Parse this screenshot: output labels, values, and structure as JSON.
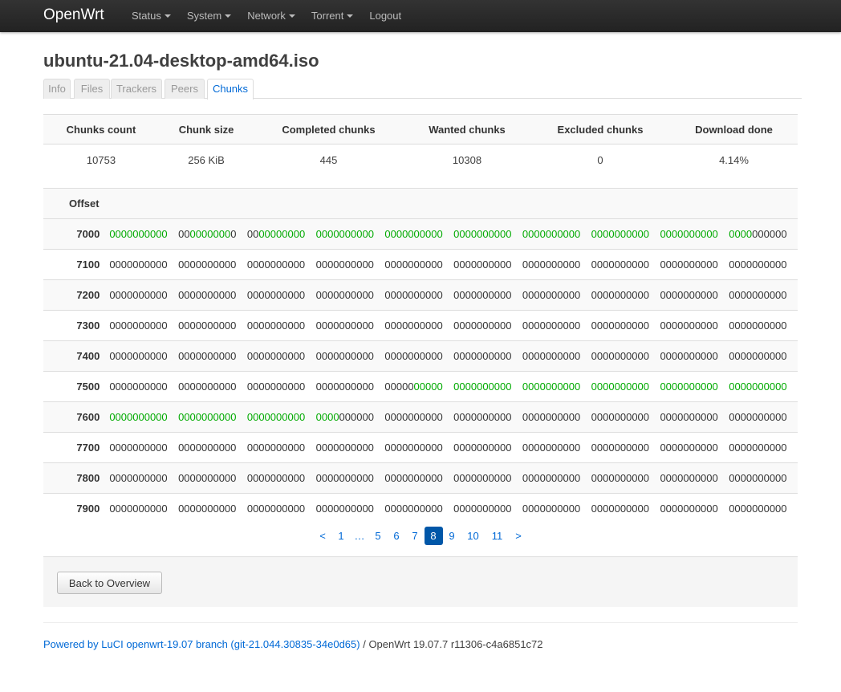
{
  "navbar": {
    "brand": "OpenWrt",
    "menu": [
      {
        "label": "Status",
        "dropdown": true
      },
      {
        "label": "System",
        "dropdown": true
      },
      {
        "label": "Network",
        "dropdown": true
      },
      {
        "label": "Torrent",
        "dropdown": true
      },
      {
        "label": "Logout",
        "dropdown": false
      }
    ]
  },
  "page_title": "ubuntu-21.04-desktop-amd64.iso",
  "tabs": [
    "Info",
    "Files",
    "Trackers",
    "Peers",
    "Chunks"
  ],
  "active_tab": "Chunks",
  "summary": {
    "headers": [
      "Chunks count",
      "Chunk size",
      "Completed chunks",
      "Wanted chunks",
      "Excluded chunks",
      "Download done"
    ],
    "values": [
      "10753",
      "256 KiB",
      "445",
      "10308",
      "0",
      "4.14%"
    ]
  },
  "chunks": {
    "offset_header": "Offset",
    "rows": [
      {
        "offset": "7000",
        "groups": [
          "0000000000",
          "0000000000",
          "0000000000",
          "0000000000",
          "0000000000",
          "0000000000",
          "0000000000",
          "0000000000",
          "0000000000",
          "0000000000"
        ]
      },
      {
        "offset": "7100",
        "groups": [
          "0000000000",
          "0000000000",
          "0000000000",
          "0000000000",
          "0000000000",
          "0000000000",
          "0000000000",
          "0000000000",
          "0000000000",
          "0000000000"
        ]
      },
      {
        "offset": "7200",
        "groups": [
          "0000000000",
          "0000000000",
          "0000000000",
          "0000000000",
          "0000000000",
          "0000000000",
          "0000000000",
          "0000000000",
          "0000000000",
          "0000000000"
        ]
      },
      {
        "offset": "7300",
        "groups": [
          "0000000000",
          "0000000000",
          "0000000000",
          "0000000000",
          "0000000000",
          "0000000000",
          "0000000000",
          "0000000000",
          "0000000000",
          "0000000000"
        ]
      },
      {
        "offset": "7400",
        "groups": [
          "0000000000",
          "0000000000",
          "0000000000",
          "0000000000",
          "0000000000",
          "0000000000",
          "0000000000",
          "0000000000",
          "0000000000",
          "0000000000"
        ]
      },
      {
        "offset": "7500",
        "groups": [
          "0000000000",
          "0000000000",
          "0000000000",
          "0000000000",
          "0000000000",
          "0000000000",
          "0000000000",
          "0000000000",
          "0000000000",
          "0000000000"
        ]
      },
      {
        "offset": "7600",
        "groups": [
          "0000000000",
          "0000000000",
          "0000000000",
          "0000000000",
          "0000000000",
          "0000000000",
          "0000000000",
          "0000000000",
          "0000000000",
          "0000000000"
        ]
      },
      {
        "offset": "7700",
        "groups": [
          "0000000000",
          "0000000000",
          "0000000000",
          "0000000000",
          "0000000000",
          "0000000000",
          "0000000000",
          "0000000000",
          "0000000000",
          "0000000000"
        ]
      },
      {
        "offset": "7800",
        "groups": [
          "0000000000",
          "0000000000",
          "0000000000",
          "0000000000",
          "0000000000",
          "0000000000",
          "0000000000",
          "0000000000",
          "0000000000",
          "0000000000"
        ]
      },
      {
        "offset": "7900",
        "groups": [
          "0000000000",
          "0000000000",
          "0000000000",
          "0000000000",
          "0000000000",
          "0000000000",
          "0000000000",
          "0000000000",
          "0000000000",
          "0000000000"
        ]
      }
    ],
    "completed_masks": {
      "7000": [
        "1111111111",
        "0011111110",
        "0011111111",
        "1111111111",
        "1111111111",
        "1111111111",
        "1111111111",
        "1111111111",
        "1111111111",
        "1111000000"
      ],
      "7500": [
        "0000000000",
        "0000000000",
        "0000000000",
        "0000000000",
        "0000011111",
        "1111111111",
        "1111111111",
        "1111111111",
        "1111111111",
        "1111111111"
      ],
      "7600": [
        "1111111111",
        "1111111111",
        "1111111111",
        "1111000000",
        "0000000000",
        "0000000000",
        "0000000000",
        "0000000000",
        "0000000000",
        "0000000000"
      ]
    },
    "completed_color": "#00aa00"
  },
  "pagination": {
    "prev": "<",
    "items": [
      "1",
      "…",
      "5",
      "6",
      "7",
      "8",
      "9",
      "10",
      "11"
    ],
    "current": "8",
    "next": ">"
  },
  "actions": {
    "back_label": "Back to Overview"
  },
  "footer": {
    "link_text": "Powered by LuCI openwrt-19.07 branch (git-21.044.30835-34e0d65)",
    "rest_text": " / OpenWrt 19.07.7 r11306-c4a6851c72"
  }
}
